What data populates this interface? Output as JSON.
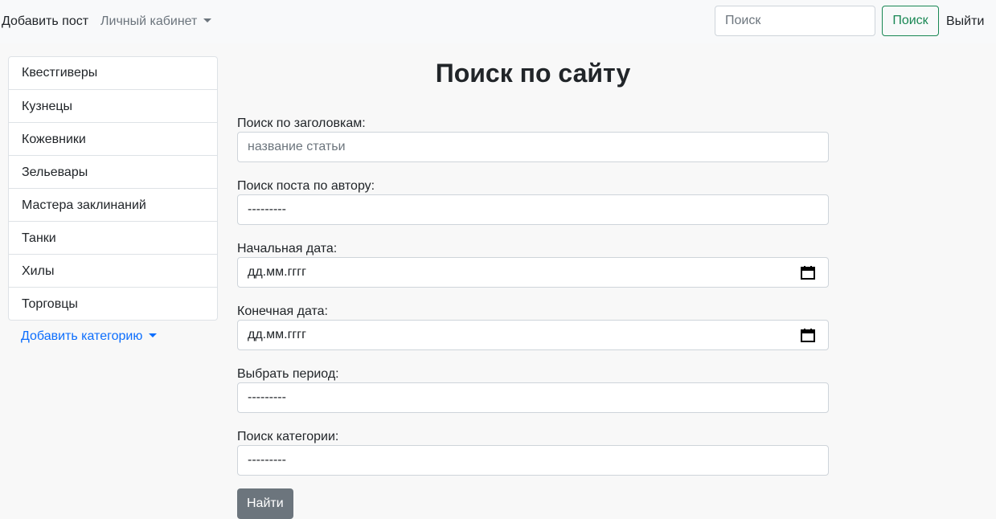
{
  "navbar": {
    "add_post": "Добавить пост",
    "cabinet": "Личный кабинет",
    "search_placeholder": "Поиск",
    "search_button": "Поиск",
    "logout": "Выйти"
  },
  "sidebar": {
    "items": [
      {
        "label": "Квестгиверы"
      },
      {
        "label": "Кузнецы"
      },
      {
        "label": "Кожевники"
      },
      {
        "label": "Зельевары"
      },
      {
        "label": "Мастера заклинаний"
      },
      {
        "label": "Танки"
      },
      {
        "label": "Хилы"
      },
      {
        "label": "Торговцы"
      }
    ],
    "add_category": "Добавить категорию"
  },
  "main": {
    "title": "Поиск по сайту",
    "title_search": {
      "label": "Поиск по заголовкам:",
      "placeholder": "название статьи"
    },
    "author": {
      "label": "Поиск поста по автору:",
      "value": "---------"
    },
    "start_date": {
      "label": "Начальная дата:",
      "value": "дд.мм.гггг"
    },
    "end_date": {
      "label": "Конечная дата:",
      "value": "дд.мм.гггг"
    },
    "period": {
      "label": "Выбрать период:",
      "value": "---------"
    },
    "category": {
      "label": "Поиск категории:",
      "value": "---------"
    },
    "submit": "Найти"
  }
}
